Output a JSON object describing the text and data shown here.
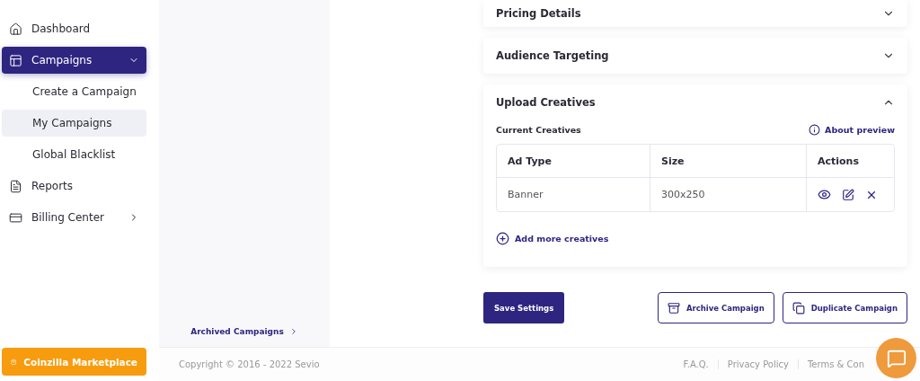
{
  "sidebar": {
    "items": [
      {
        "label": "Dashboard",
        "selected": false
      },
      {
        "label": "Campaigns",
        "selected": true,
        "expanded": true,
        "children": [
          {
            "label": "Create a Campaign",
            "selected": false
          },
          {
            "label": "My Campaigns",
            "selected": true
          },
          {
            "label": "Global Blacklist",
            "selected": false
          }
        ]
      },
      {
        "label": "Reports",
        "selected": false
      },
      {
        "label": "Billing Center",
        "selected": false,
        "expanded": false
      }
    ],
    "marketplace_button": "Coinzilla Marketplace"
  },
  "subpanel": {
    "link": "Archived Campaigns"
  },
  "sections": [
    {
      "title": "Pricing Details",
      "expanded": false
    },
    {
      "title": "Audience Targeting",
      "expanded": false
    },
    {
      "title": "Upload Creatives",
      "expanded": true,
      "subtitle": "Current Creatives",
      "about_link": "About preview",
      "table": {
        "columns": [
          "Ad Type",
          "Size",
          "Actions"
        ],
        "rows": [
          {
            "ad_type": "Banner",
            "size": "300x250"
          }
        ]
      },
      "add_link": "Add more creatives"
    }
  ],
  "actions": {
    "save": "Save Settings",
    "archive": "Archive Campaign",
    "duplicate": "Duplicate Campaign"
  },
  "footer": {
    "copyright": "Copyright © 2016 - 2022 Sevio",
    "links": [
      "F.A.Q.",
      "Privacy Policy",
      "Terms & Con"
    ]
  }
}
